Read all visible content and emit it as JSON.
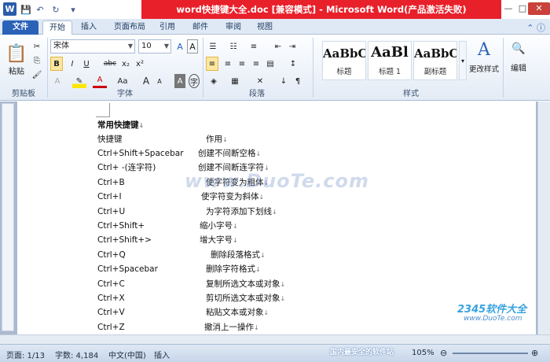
{
  "title_bar": {
    "title": "word快捷键大全.doc [兼容模式] - Microsoft Word(产品激活失败)",
    "app_icon": "W",
    "quick_access": [
      "save-icon",
      "undo-icon",
      "redo-icon",
      "customize-icon"
    ],
    "minimize": "—",
    "maximize": "□",
    "close": "✕"
  },
  "tabs": [
    "文件",
    "开始",
    "插入",
    "页面布局",
    "引用",
    "邮件",
    "审阅",
    "视图"
  ],
  "ribbon": {
    "clipboard": {
      "paste": "粘贴",
      "label": "剪贴板"
    },
    "font": {
      "name": "宋体",
      "size": "10",
      "label": "字体",
      "buttons": [
        "B",
        "I",
        "U",
        "abc",
        "x₂",
        "x²",
        "A",
        "Aa",
        "A",
        "A"
      ]
    },
    "paragraph": {
      "label": "段落"
    },
    "styles": {
      "label": "样式",
      "items": [
        {
          "sample": "AaBbC",
          "name": "标题"
        },
        {
          "sample": "AaBl",
          "name": "标题 1"
        },
        {
          "sample": "AaBbC",
          "name": "副标题"
        }
      ],
      "change": "更改样式"
    },
    "edit": {
      "label": "编辑"
    }
  },
  "document": {
    "heading": "常用快捷键",
    "header_key": "快捷键",
    "header_value": "作用",
    "rows": [
      {
        "key": "Ctrl+Shift+Spacebar",
        "value": "创建不间断空格"
      },
      {
        "key": "Ctrl+ -(连字符)",
        "value": "创建不间断连字符"
      },
      {
        "key": "Ctrl+B",
        "value": "使字符变为粗体"
      },
      {
        "key": "Ctrl+I",
        "value": "使字符变为斜体"
      },
      {
        "key": "Ctrl+U",
        "value": "为字符添加下划线"
      },
      {
        "key": "Ctrl+Shift+",
        "value": "缩小字号"
      },
      {
        "key": "Ctrl+Shift+>",
        "value": "增大字号"
      },
      {
        "key": "Ctrl+Q",
        "value": "删除段落格式"
      },
      {
        "key": "Ctrl+Spacebar",
        "value": "删除字符格式"
      },
      {
        "key": "Ctrl+C",
        "value": "复制所选文本或对象"
      },
      {
        "key": "Ctrl+X",
        "value": "剪切所选文本或对象"
      },
      {
        "key": "Ctrl+V",
        "value": "粘贴文本或对象"
      },
      {
        "key": "Ctrl+Z",
        "value": "撤消上一操作"
      }
    ],
    "watermark": "www.DuoTe.com",
    "watermark2_brand": "2345软件大全",
    "watermark2_url": "www.DuoTe.com"
  },
  "status_bar": {
    "page": "页面: 1/13",
    "words": "字数: 4,184",
    "language": "中文(中国)",
    "mode": "插入",
    "zoom": "105%",
    "ad": "国内最安全的软件站"
  }
}
